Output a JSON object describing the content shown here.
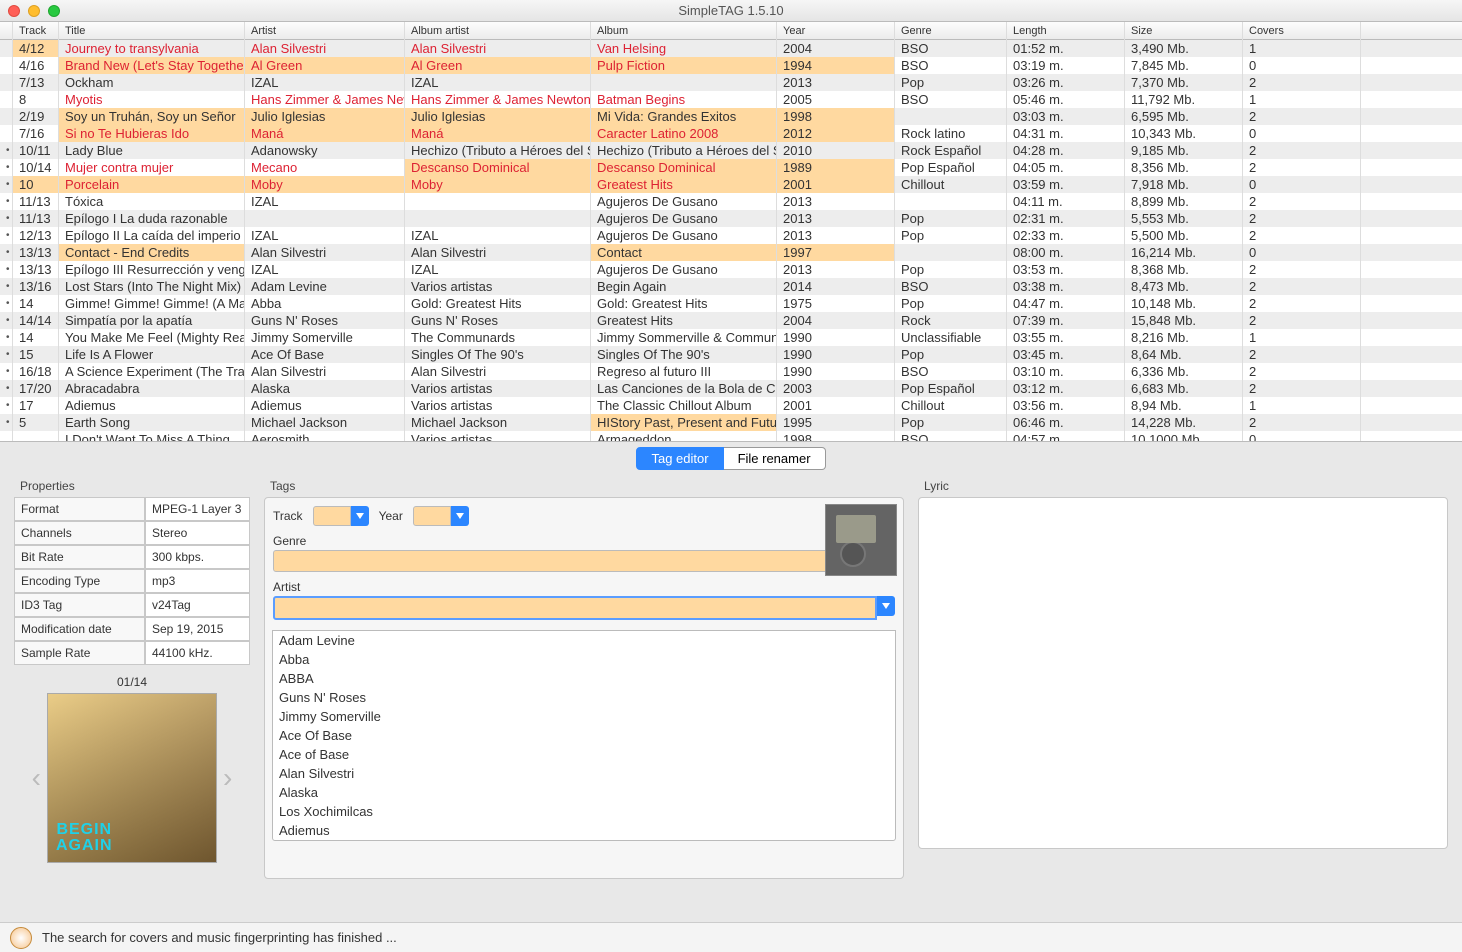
{
  "window_title": "SimpleTAG 1.5.10",
  "columns": [
    "Track",
    "Title",
    "Artist",
    "Album artist",
    "Album",
    "Year",
    "Genre",
    "Length",
    "Size",
    "Covers"
  ],
  "rows": [
    {
      "dot": "",
      "track": "4/12",
      "title": "Journey to transylvania",
      "artist": "Alan Silvestri",
      "album_artist": "Alan Silvestri",
      "album": "Van Helsing",
      "year": "2004",
      "genre": "BSO",
      "length": "01:52 m.",
      "size": "3,490 Mb.",
      "covers": "1",
      "red": true,
      "hl": [
        "track"
      ]
    },
    {
      "dot": "",
      "track": "4/16",
      "title": "Brand New (Let's Stay Together)",
      "artist": "Al Green",
      "album_artist": "Al Green",
      "album": "Pulp Fiction",
      "year": "1994",
      "genre": "BSO",
      "length": "03:19 m.",
      "size": "7,845 Mb.",
      "covers": "0",
      "red": true,
      "hl": [
        "title",
        "artist",
        "album_artist",
        "album",
        "year"
      ]
    },
    {
      "dot": "",
      "track": "7/13",
      "title": "Ockham",
      "artist": "IZAL",
      "album_artist": "IZAL",
      "album": "",
      "year": "2013",
      "genre": "Pop",
      "length": "03:26 m.",
      "size": "7,370 Mb.",
      "covers": "2",
      "red": false,
      "hl": []
    },
    {
      "dot": "",
      "track": "8",
      "title": "Myotis",
      "artist": "Hans Zimmer & James New",
      "album_artist": "Hans Zimmer & James Newton H",
      "album": "Batman Begins",
      "year": "2005",
      "genre": "BSO",
      "length": "05:46 m.",
      "size": "11,792 Mb.",
      "covers": "1",
      "red": true,
      "hl": []
    },
    {
      "dot": "",
      "track": "2/19",
      "title": "Soy un Truhán, Soy un Señor",
      "artist": "Julio Iglesias",
      "album_artist": "Julio Iglesias",
      "album": "Mi Vida: Grandes Exitos",
      "year": "1998",
      "genre": "",
      "length": "03:03 m.",
      "size": "6,595 Mb.",
      "covers": "2",
      "red": false,
      "hl": [
        "title",
        "artist",
        "album_artist",
        "album",
        "year"
      ]
    },
    {
      "dot": "",
      "track": "7/16",
      "title": "Si no Te Hubieras Ido",
      "artist": "Maná",
      "album_artist": "Maná",
      "album": "Caracter Latino 2008",
      "year": "2012",
      "genre": "Rock latino",
      "length": "04:31 m.",
      "size": "10,343 Mb.",
      "covers": "0",
      "red": true,
      "hl": [
        "title",
        "artist",
        "album_artist",
        "album",
        "year"
      ]
    },
    {
      "dot": "•",
      "track": "10/11",
      "title": "Lady Blue",
      "artist": "Adanowsky",
      "album_artist": "Hechizo (Tributo a Héroes del Si",
      "album": "Hechizo (Tributo a Héroes del Si",
      "year": "2010",
      "genre": "Rock Español",
      "length": "04:28 m.",
      "size": "9,185 Mb.",
      "covers": "2",
      "red": false,
      "hl": []
    },
    {
      "dot": "•",
      "track": "10/14",
      "title": "Mujer contra mujer",
      "artist": "Mecano",
      "album_artist": "Descanso Dominical",
      "album": "Descanso Dominical",
      "year": "1989",
      "genre": "Pop Español",
      "length": "04:05 m.",
      "size": "8,356 Mb.",
      "covers": "2",
      "red": true,
      "hl": [
        "album_artist",
        "album",
        "year"
      ]
    },
    {
      "dot": "•",
      "track": "10",
      "title": "Porcelain",
      "artist": "Moby",
      "album_artist": "Moby",
      "album": "Greatest Hits",
      "year": "2001",
      "genre": "Chillout",
      "length": "03:59 m.",
      "size": "7,918 Mb.",
      "covers": "0",
      "red": true,
      "hl": [
        "track",
        "title",
        "artist",
        "album_artist",
        "album",
        "year"
      ]
    },
    {
      "dot": "•",
      "track": "11/13",
      "title": "Tóxica",
      "artist": "IZAL",
      "album_artist": "",
      "album": "Agujeros De Gusano",
      "year": "2013",
      "genre": "",
      "length": "04:11 m.",
      "size": "8,899 Mb.",
      "covers": "2",
      "red": false,
      "hl": []
    },
    {
      "dot": "•",
      "track": "11/13",
      "title": "Epílogo I La duda razonable",
      "artist": "",
      "album_artist": "",
      "album": "Agujeros De Gusano",
      "year": "2013",
      "genre": "Pop",
      "length": "02:31 m.",
      "size": "5,553 Mb.",
      "covers": "2",
      "red": false,
      "hl": []
    },
    {
      "dot": "•",
      "track": "12/13",
      "title": "Epílogo II La caída del imperio",
      "artist": "IZAL",
      "album_artist": "IZAL",
      "album": "Agujeros De Gusano",
      "year": "2013",
      "genre": "Pop",
      "length": "02:33 m.",
      "size": "5,500 Mb.",
      "covers": "2",
      "red": false,
      "hl": []
    },
    {
      "dot": "•",
      "track": "13/13",
      "title": "Contact - End Credits",
      "artist": "Alan Silvestri",
      "album_artist": "Alan Silvestri",
      "album": "Contact",
      "year": "1997",
      "genre": "",
      "length": "08:00 m.",
      "size": "16,214 Mb.",
      "covers": "0",
      "red": false,
      "hl": [
        "title",
        "album",
        "year"
      ]
    },
    {
      "dot": "•",
      "track": "13/13",
      "title": "Epílogo III Resurrección y venga",
      "artist": "IZAL",
      "album_artist": "IZAL",
      "album": "Agujeros De Gusano",
      "year": "2013",
      "genre": "Pop",
      "length": "03:53 m.",
      "size": "8,368 Mb.",
      "covers": "2",
      "red": false,
      "hl": []
    },
    {
      "dot": "•",
      "track": "13/16",
      "title": "Lost Stars (Into The Night Mix)",
      "artist": "Adam Levine",
      "album_artist": "Varios artistas",
      "album": "Begin Again",
      "year": "2014",
      "genre": "BSO",
      "length": "03:38 m.",
      "size": "8,473 Mb.",
      "covers": "2",
      "red": false,
      "hl": []
    },
    {
      "dot": "•",
      "track": "14",
      "title": "Gimme! Gimme! Gimme! (A Man",
      "artist": "Abba",
      "album_artist": "Gold: Greatest Hits",
      "album": "Gold: Greatest Hits",
      "year": "1975",
      "genre": "Pop",
      "length": "04:47 m.",
      "size": "10,148 Mb.",
      "covers": "2",
      "red": false,
      "hl": []
    },
    {
      "dot": "•",
      "track": "14/14",
      "title": "Simpatía por la apatía",
      "artist": "Guns N' Roses",
      "album_artist": "Guns N' Roses",
      "album": "Greatest Hits",
      "year": "2004",
      "genre": "Rock",
      "length": "07:39 m.",
      "size": "15,848 Mb.",
      "covers": "2",
      "red": false,
      "hl": []
    },
    {
      "dot": "•",
      "track": "14",
      "title": "You Make Me Feel (Mighty Real)",
      "artist": "Jimmy Somerville",
      "album_artist": "The Communards",
      "album": "Jimmy Sommerville & Communa",
      "year": "1990",
      "genre": "Unclassifiable",
      "length": "03:55 m.",
      "size": "8,216 Mb.",
      "covers": "1",
      "red": false,
      "hl": []
    },
    {
      "dot": "•",
      "track": "15",
      "title": "Life Is A Flower",
      "artist": "Ace Of Base",
      "album_artist": "Singles Of The 90's",
      "album": "Singles Of The 90's",
      "year": "1990",
      "genre": "Pop",
      "length": "03:45 m.",
      "size": "8,64 Mb.",
      "covers": "2",
      "red": false,
      "hl": []
    },
    {
      "dot": "•",
      "track": "16/18",
      "title": "A Science Experiment  (The Trai",
      "artist": "Alan Silvestri",
      "album_artist": "Alan Silvestri",
      "album": "Regreso al futuro III",
      "year": "1990",
      "genre": "BSO",
      "length": "03:10 m.",
      "size": "6,336 Mb.",
      "covers": "2",
      "red": false,
      "hl": []
    },
    {
      "dot": "•",
      "track": "17/20",
      "title": "Abracadabra",
      "artist": "Alaska",
      "album_artist": "Varios artistas",
      "album": "Las Canciones de la Bola de Cris",
      "year": "2003",
      "genre": "Pop Español",
      "length": "03:12 m.",
      "size": "6,683 Mb.",
      "covers": "2",
      "red": false,
      "hl": []
    },
    {
      "dot": "•",
      "track": "17",
      "title": "Adiemus",
      "artist": "Adiemus",
      "album_artist": "Varios artistas",
      "album": "The Classic Chillout Album",
      "year": "2001",
      "genre": "Chillout",
      "length": "03:56 m.",
      "size": "8,94 Mb.",
      "covers": "1",
      "red": false,
      "hl": []
    },
    {
      "dot": "•",
      "track": "5",
      "title": "Earth Song",
      "artist": "Michael Jackson",
      "album_artist": "Michael Jackson",
      "album": "HIStory Past, Present and Future",
      "year": "1995",
      "genre": "Pop",
      "length": "06:46 m.",
      "size": "14,228 Mb.",
      "covers": "2",
      "red": false,
      "hl": [
        "album"
      ]
    },
    {
      "dot": "",
      "track": "",
      "title": "I Don't Want To Miss A Thing",
      "artist": "Aerosmith",
      "album_artist": "Varios artistas",
      "album": "Armageddon",
      "year": "1998",
      "genre": "BSO",
      "length": "04:57 m.",
      "size": "10,1000 Mb.",
      "covers": "0",
      "red": false,
      "hl": []
    }
  ],
  "segmented": {
    "tag_editor": "Tag editor",
    "file_renamer": "File renamer"
  },
  "properties": {
    "label": "Properties",
    "rows": [
      [
        "Format",
        "MPEG-1 Layer 3"
      ],
      [
        "Channels",
        "Stereo"
      ],
      [
        "Bit Rate",
        "300 kbps."
      ],
      [
        "Encoding Type",
        "mp3"
      ],
      [
        "ID3 Tag",
        "v24Tag"
      ],
      [
        "Modification date",
        "Sep 19, 2015"
      ],
      [
        "Sample Rate",
        "44100 kHz."
      ]
    ],
    "cover_counter": "01/14",
    "cover_text": "BEGIN\nAGAIN"
  },
  "tags": {
    "label": "Tags",
    "track_label": "Track",
    "year_label": "Year",
    "genre_label": "Genre",
    "artist_label": "Artist",
    "artist_options": [
      "Adam Levine",
      "Abba",
      "ABBA",
      "Guns N' Roses",
      "Jimmy Somerville",
      "Ace Of Base",
      "Ace of Base",
      "Alan Silvestri",
      "Alaska",
      "Los Xochimilcas",
      "Adiemus"
    ]
  },
  "lyric_label": "Lyric",
  "status_text": "The search for covers and music fingerprinting has finished ..."
}
